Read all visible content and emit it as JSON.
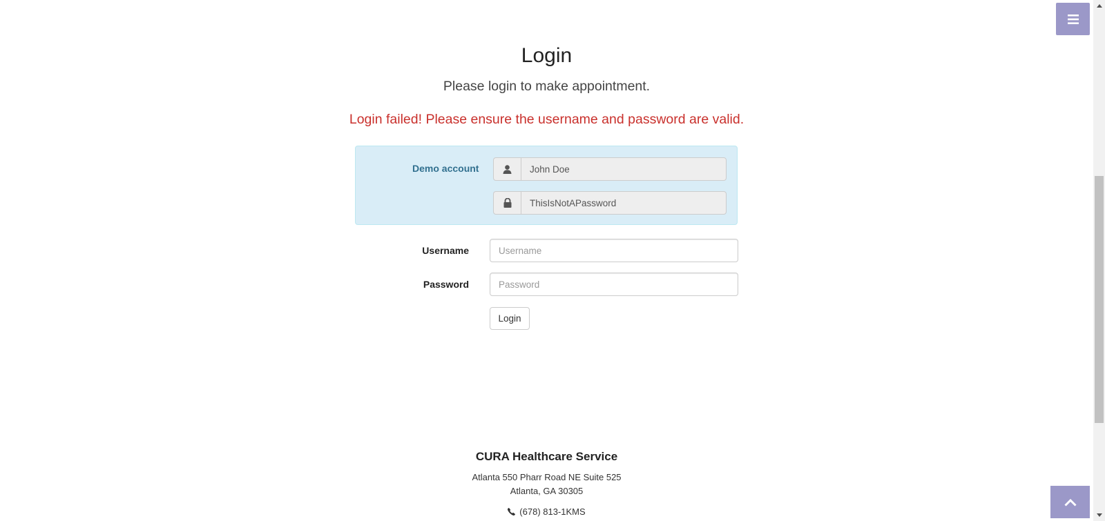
{
  "header": {
    "menu_icon": "bars-icon"
  },
  "login": {
    "title": "Login",
    "subtitle": "Please login to make appointment.",
    "error_message": "Login failed! Please ensure the username and password are valid."
  },
  "demo": {
    "label": "Demo account",
    "username_value": "John Doe",
    "password_value": "ThisIsNotAPassword",
    "user_icon": "user-icon",
    "lock_icon": "lock-icon"
  },
  "form": {
    "username_label": "Username",
    "username_placeholder": "Username",
    "password_label": "Password",
    "password_placeholder": "Password",
    "submit_label": "Login"
  },
  "footer": {
    "company": "CURA Healthcare Service",
    "address_line1": "Atlanta 550 Pharr Road NE Suite 525",
    "address_line2": "Atlanta, GA 30305",
    "phone": "(678) 813-1KMS",
    "phone_icon": "phone-icon"
  },
  "colors": {
    "accent": "#9b98c8",
    "error": "#c9302c",
    "info_bg": "#d9edf7",
    "info_border": "#bce8f1",
    "info_text": "#31708f"
  }
}
